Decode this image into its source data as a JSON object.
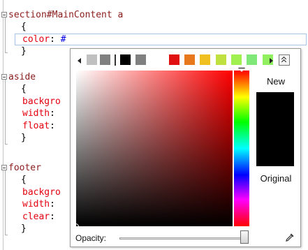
{
  "editor": {
    "lines": [
      {
        "id": "l1",
        "parts": [
          {
            "cls": "sel",
            "t": "section#MainContent a"
          }
        ]
      },
      {
        "id": "l2",
        "parts": [
          {
            "cls": "punc",
            "t": "{"
          }
        ]
      },
      {
        "id": "l3",
        "parts": [
          {
            "cls": "prop",
            "t": "color"
          },
          {
            "cls": "punc",
            "t": ": "
          },
          {
            "cls": "val",
            "t": "#"
          }
        ]
      },
      {
        "id": "l4",
        "parts": [
          {
            "cls": "punc",
            "t": "}"
          }
        ]
      },
      {
        "id": "l5",
        "parts": [
          {
            "cls": "sel",
            "t": "aside"
          }
        ]
      },
      {
        "id": "l6",
        "parts": [
          {
            "cls": "punc",
            "t": "{"
          }
        ]
      },
      {
        "id": "l7",
        "parts": [
          {
            "cls": "prop",
            "t": "backgro"
          }
        ]
      },
      {
        "id": "l8",
        "parts": [
          {
            "cls": "prop",
            "t": "width"
          },
          {
            "cls": "punc",
            "t": ":"
          }
        ]
      },
      {
        "id": "l9",
        "parts": [
          {
            "cls": "prop",
            "t": "float"
          },
          {
            "cls": "punc",
            "t": ":"
          }
        ]
      },
      {
        "id": "l10",
        "parts": [
          {
            "cls": "punc",
            "t": "}"
          }
        ]
      },
      {
        "id": "l11",
        "parts": [
          {
            "cls": "sel",
            "t": "footer"
          }
        ]
      },
      {
        "id": "l12",
        "parts": [
          {
            "cls": "punc",
            "t": "{"
          }
        ]
      },
      {
        "id": "l13",
        "parts": [
          {
            "cls": "prop",
            "t": "backgro"
          }
        ]
      },
      {
        "id": "l14",
        "parts": [
          {
            "cls": "prop",
            "t": "width"
          },
          {
            "cls": "punc",
            "t": ":"
          }
        ]
      },
      {
        "id": "l15",
        "parts": [
          {
            "cls": "prop",
            "t": "clear"
          },
          {
            "cls": "punc",
            "t": ":"
          }
        ]
      },
      {
        "id": "l16",
        "parts": [
          {
            "cls": "punc",
            "t": "}"
          }
        ]
      }
    ]
  },
  "picker": {
    "swatches": [
      {
        "name": "light-gray",
        "color": "#c0c0c0"
      },
      {
        "name": "gray",
        "color": "#808080"
      },
      {
        "name": "black",
        "color": "#000000"
      },
      {
        "name": "dark-gray",
        "color": "#808080"
      },
      {
        "name": "red",
        "color": "#e01010"
      },
      {
        "name": "orange",
        "color": "#e8781c"
      },
      {
        "name": "yellow",
        "color": "#f0c020"
      },
      {
        "name": "yellow-green",
        "color": "#c0e040"
      },
      {
        "name": "light-green",
        "color": "#a0f050"
      },
      {
        "name": "green",
        "color": "#80e878"
      },
      {
        "name": "bright-green",
        "color": "#90f060"
      }
    ],
    "new_label": "New",
    "original_label": "Original",
    "preview_color": "#000000",
    "opacity_label": "Opacity:",
    "opacity_value": 1.0,
    "icons": {
      "prev": "arrow-left-icon",
      "next": "arrow-right-icon",
      "collapse": "double-chevron-up-icon",
      "eyedropper": "eyedropper-icon"
    }
  }
}
